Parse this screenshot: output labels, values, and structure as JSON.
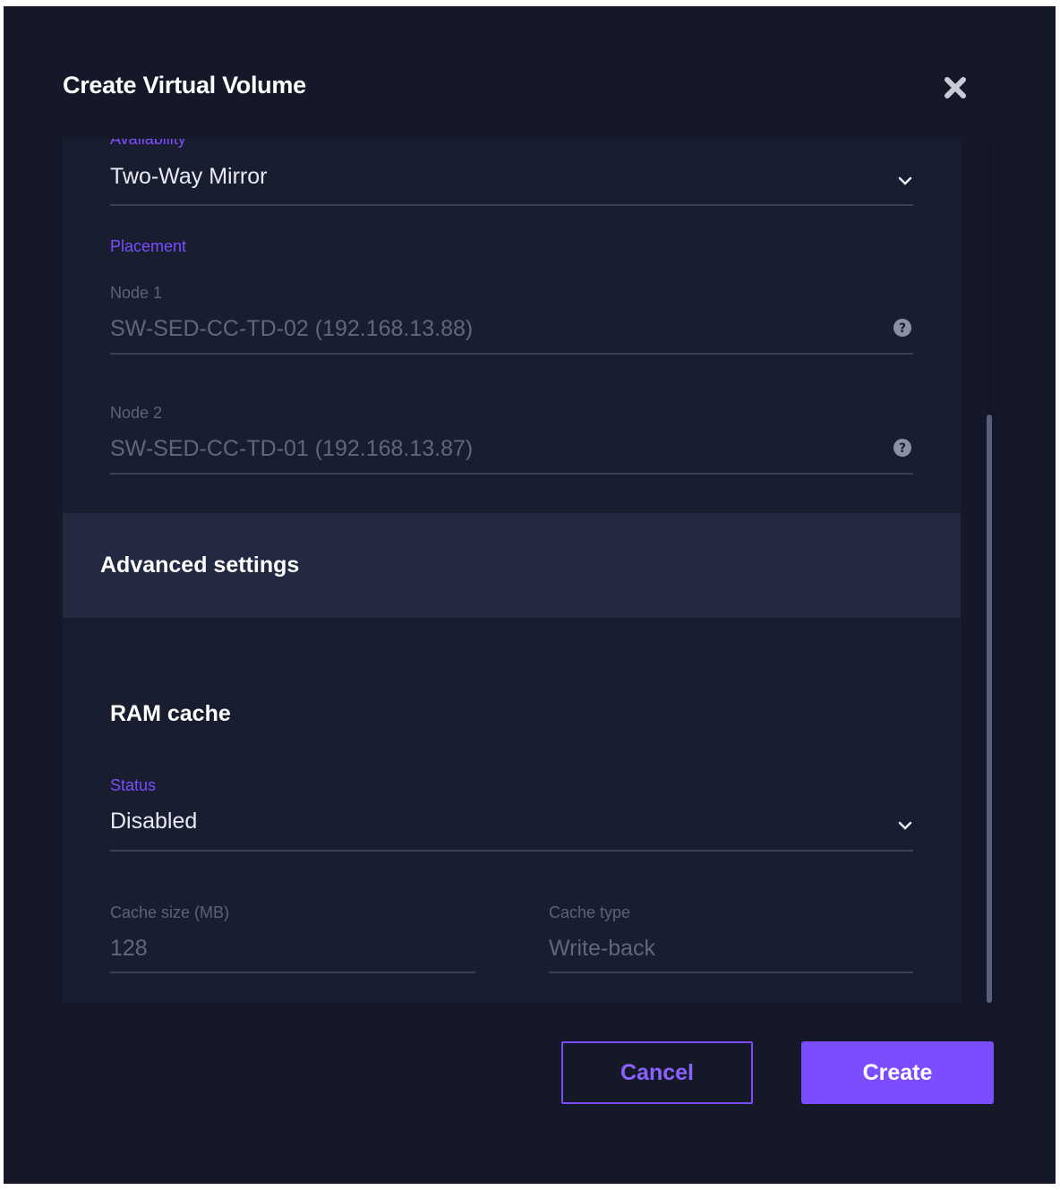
{
  "dialog": {
    "title": "Create Virtual Volume"
  },
  "availability": {
    "label": "Availability",
    "value": "Two-Way Mirror"
  },
  "placement": {
    "heading": "Placement",
    "node1": {
      "label": "Node 1",
      "value": "SW-SED-CC-TD-02 (192.168.13.88)"
    },
    "node2": {
      "label": "Node 2",
      "value": "SW-SED-CC-TD-01 (192.168.13.87)"
    }
  },
  "advanced": {
    "title": "Advanced settings"
  },
  "ram_cache": {
    "title": "RAM cache",
    "status_label": "Status",
    "status_value": "Disabled",
    "size_label": "Cache size (MB)",
    "size_value": "128",
    "type_label": "Cache type",
    "type_value": "Write-back"
  },
  "buttons": {
    "cancel": "Cancel",
    "create": "Create"
  },
  "colors": {
    "accent": "#7c4dff",
    "background": "#141828",
    "panel": "#181d30",
    "band": "#222940"
  }
}
